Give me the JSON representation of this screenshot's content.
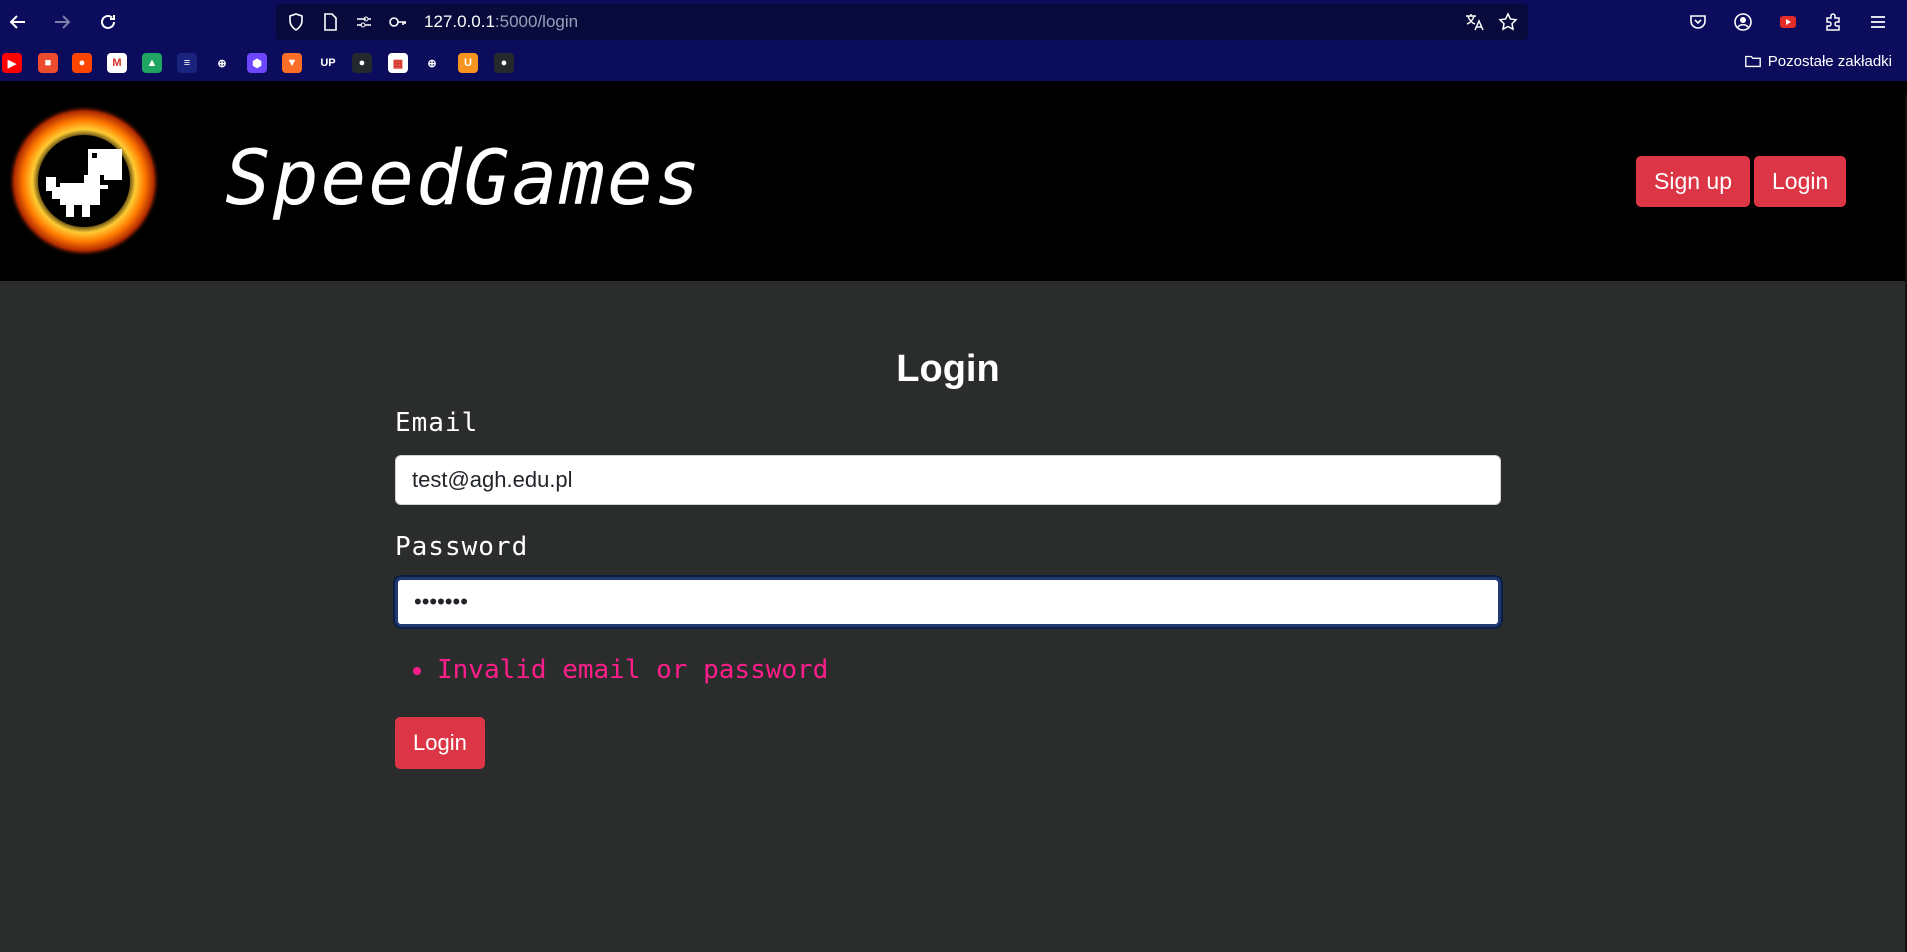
{
  "browser": {
    "url_host": "127.0.0.1",
    "url_path": ":5000/login",
    "bookmarks_folder": "Pozostałe zakładki",
    "bookmarks": [
      {
        "icon": "youtube-icon",
        "color": "#ff0000",
        "glyph": "▶"
      },
      {
        "icon": "shop-icon",
        "color": "#ee4d2d",
        "glyph": "■"
      },
      {
        "icon": "reddit-icon",
        "color": "#ff4500",
        "glyph": "●"
      },
      {
        "icon": "gmail-icon",
        "color": "#ffffff",
        "glyph": "M"
      },
      {
        "icon": "drive-icon",
        "color": "#1fa463",
        "glyph": "▲"
      },
      {
        "icon": "list-icon",
        "color": "#1a237e",
        "glyph": "≡"
      },
      {
        "icon": "globe-icon",
        "color": "#0b0c5c",
        "glyph": "⊕"
      },
      {
        "icon": "hexagon-icon",
        "color": "#6c47ff",
        "glyph": "⬢"
      },
      {
        "icon": "gitlab-icon",
        "color": "#fc6d26",
        "glyph": "▼"
      },
      {
        "icon": "upel-icon",
        "color": "#0b0c5c",
        "glyph": "UP"
      },
      {
        "icon": "github-icon",
        "color": "#24292e",
        "glyph": "●"
      },
      {
        "icon": "photo-icon",
        "color": "#ffffff",
        "glyph": "▦"
      },
      {
        "icon": "globe-icon",
        "color": "#0b0c5c",
        "glyph": "⊕"
      },
      {
        "icon": "u-icon",
        "color": "#f7941d",
        "glyph": "U"
      },
      {
        "icon": "github-icon",
        "color": "#24292e",
        "glyph": "●"
      }
    ]
  },
  "header": {
    "brand": "SpeedGames",
    "signup_label": "Sign up",
    "login_label": "Login"
  },
  "form": {
    "title": "Login",
    "email_label": "Email",
    "email_value": "test@agh.edu.pl",
    "password_label": "Password",
    "password_value": "•••••••",
    "error": "Invalid email or password",
    "submit_label": "Login"
  },
  "colors": {
    "accent": "#dc3545",
    "error": "#ff1e8a",
    "page_bg": "#2b2c2c",
    "browser_chrome": "#0b0c5c"
  }
}
